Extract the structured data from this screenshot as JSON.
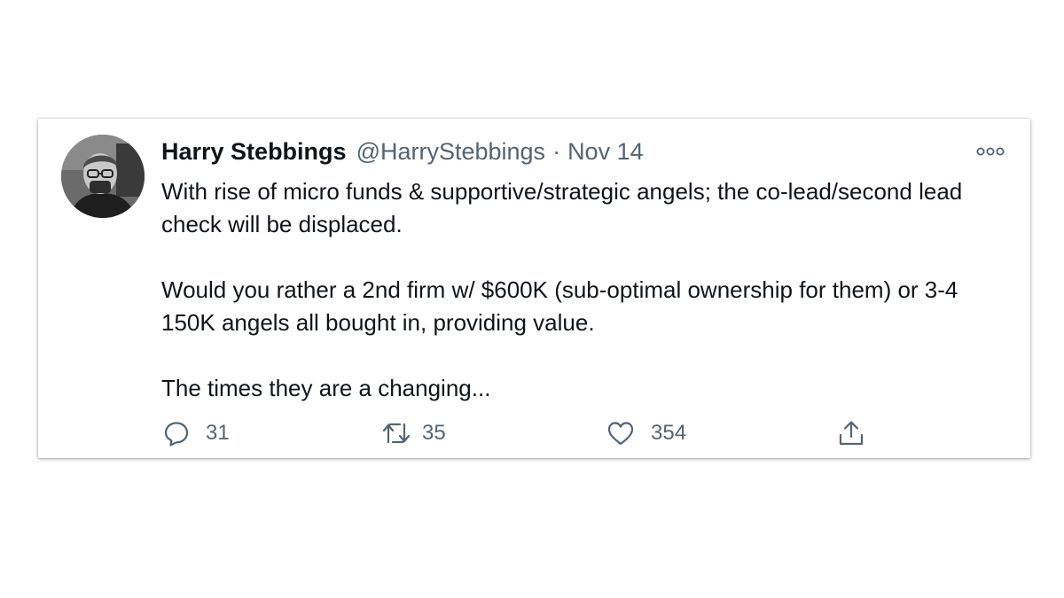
{
  "tweet": {
    "author": {
      "display_name": "Harry Stebbings",
      "handle": "@HarryStebbings"
    },
    "separator": "·",
    "date": "Nov 14",
    "paragraphs": [
      "With rise of micro funds & supportive/strategic angels; the co-lead/second lead check will be displaced.",
      "Would you rather a 2nd firm w/ $600K (sub-optimal ownership for them) or 3-4 150K angels all bought in, providing value.",
      "The times they are a changing..."
    ],
    "actions": {
      "reply_count": "31",
      "retweet_count": "35",
      "like_count": "354"
    }
  },
  "icons": {
    "more": "more-options-icon",
    "reply": "reply-icon",
    "retweet": "retweet-icon",
    "like": "heart-icon",
    "share": "share-icon"
  },
  "colors": {
    "text": "#0f1419",
    "secondary_text": "#536471",
    "icon": "#536471"
  }
}
